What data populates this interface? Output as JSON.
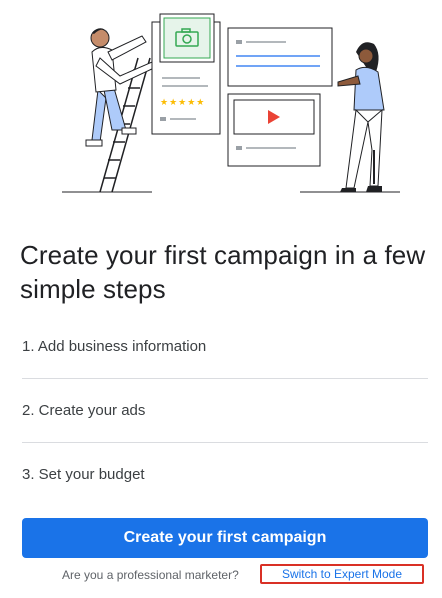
{
  "headline": "Create your first campaign in a few simple steps",
  "steps": [
    {
      "label": "1. Add business information"
    },
    {
      "label": "2. Create your ads"
    },
    {
      "label": "3. Set your budget"
    }
  ],
  "cta": {
    "label": "Create your first campaign"
  },
  "footer": {
    "question": "Are you a professional marketer?",
    "link_label": "Switch to Expert Mode"
  },
  "illustration": {
    "rating_stars": "★★★★★",
    "icons": [
      "camera-icon",
      "play-icon"
    ]
  },
  "colors": {
    "primary": "#1a73e8",
    "highlight_border": "#d93025",
    "star": "#fbbc04",
    "photo_frame": "#34a853",
    "play": "#ea4335",
    "divider": "#dadce0"
  }
}
